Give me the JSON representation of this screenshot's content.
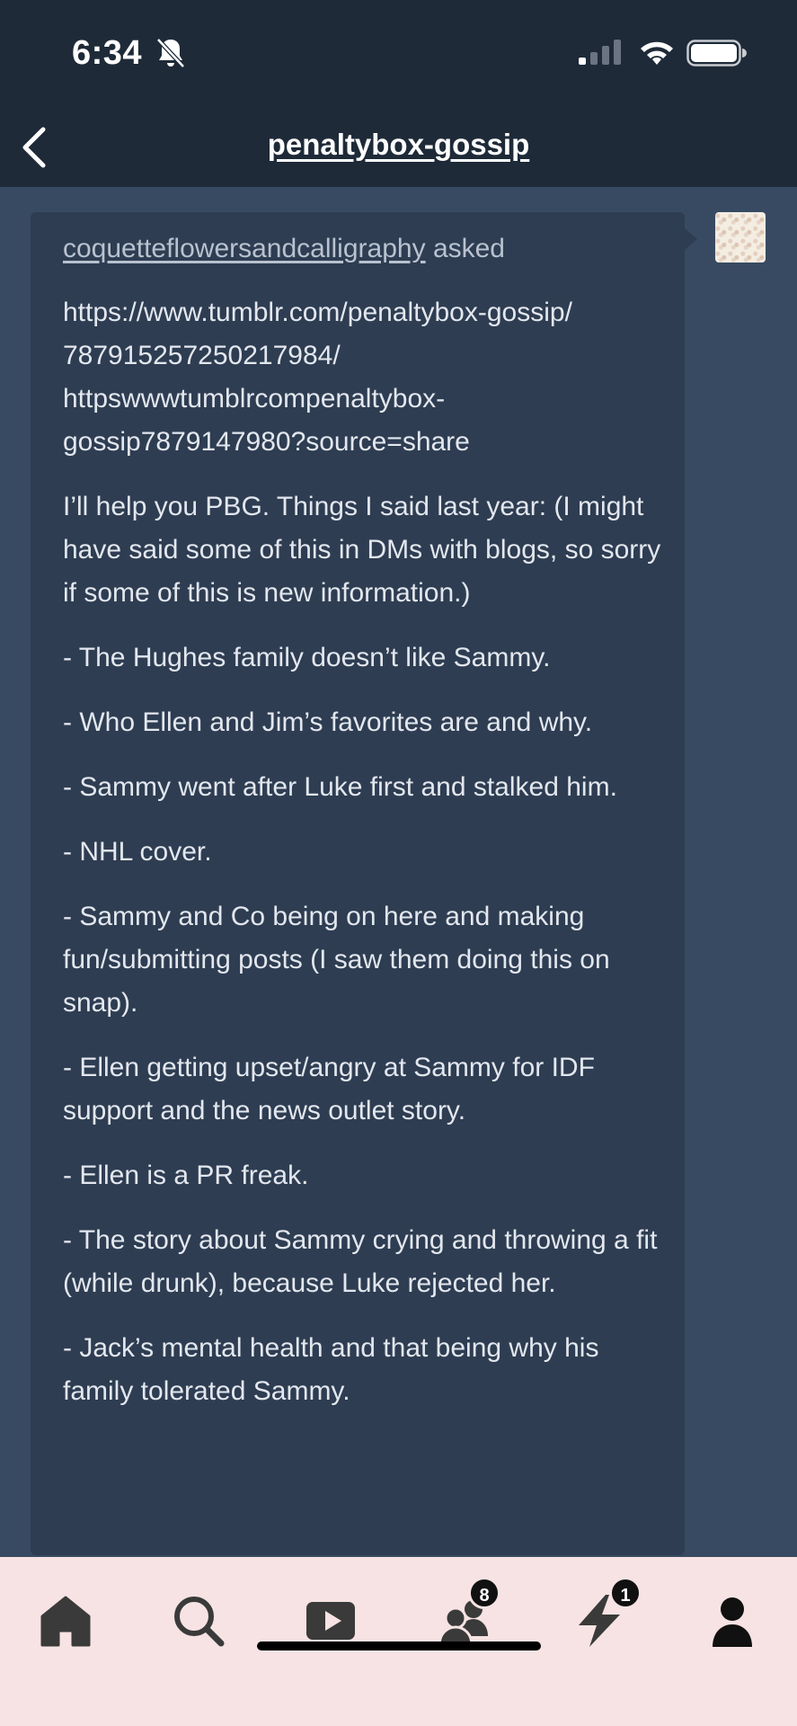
{
  "status_bar": {
    "time": "6:34",
    "icons": [
      "bell-off-icon",
      "signal-icon",
      "wifi-icon",
      "battery-icon"
    ]
  },
  "nav": {
    "back_icon": "chevron-left-icon",
    "title": "penaltybox-gossip"
  },
  "ask": {
    "asker": "coquetteflowersandcalligraphy",
    "verb": "asked",
    "url_lines": [
      "https://www.tumblr.com/penaltybox-gossip/",
      "787915257250217984/",
      "httpswwwtumblrcompenaltybox-",
      "gossip7879147980?source=share"
    ],
    "paragraphs": [
      "I’ll help you PBG. Things I said last year: (I might have said some of this in DMs with blogs, so sorry if some of this is new information.)",
      "- The Hughes family doesn’t like Sammy.",
      "- Who Ellen and Jim’s favorites are and why.",
      "- Sammy went after Luke first and stalked him.",
      "- NHL cover.",
      "- Sammy and Co being on here and making fun/submitting posts (I saw them doing this on snap).",
      "- Ellen getting upset/angry at Sammy for IDF support and the news outlet story.",
      "- Ellen is a PR freak.",
      "- The story about Sammy crying and throwing a fit (while drunk), because Luke rejected her.",
      "- Jack’s mental health and that being why his family tolerated Sammy."
    ]
  },
  "tabbar": {
    "tabs": [
      {
        "name": "home",
        "icon": "home-icon"
      },
      {
        "name": "search",
        "icon": "search-icon"
      },
      {
        "name": "video",
        "icon": "play-icon"
      },
      {
        "name": "communities",
        "icon": "people-icon",
        "badge": "8"
      },
      {
        "name": "activity",
        "icon": "lightning-icon",
        "badge": "1"
      },
      {
        "name": "account",
        "icon": "person-icon"
      }
    ]
  },
  "colors": {
    "header_bg": "#1e2a38",
    "page_bg": "#384a61",
    "card_bg": "#2e3d52",
    "tabbar_bg": "#f7e3e3",
    "icon_color": "#3a3a3a"
  }
}
